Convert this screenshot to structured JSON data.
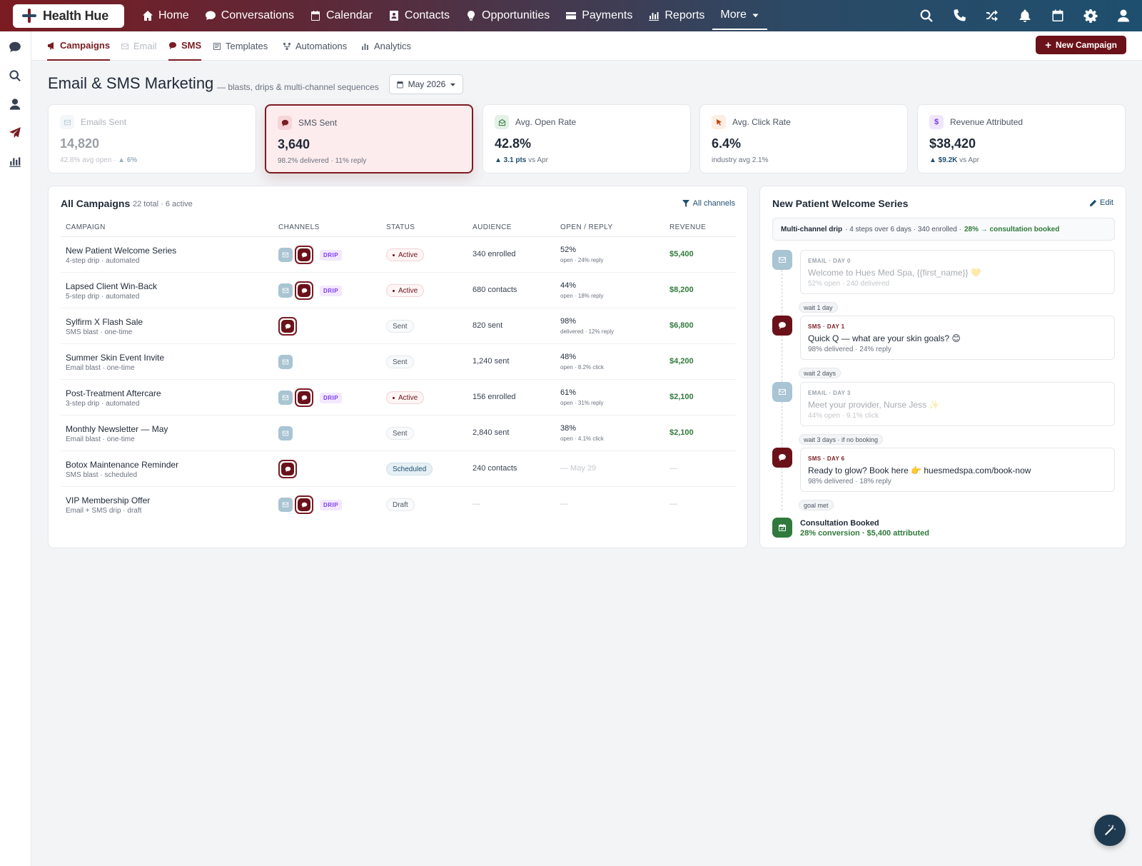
{
  "brand": {
    "name": "Health Hue"
  },
  "topnav": {
    "items": [
      {
        "label": "Home",
        "icon": "home-icon"
      },
      {
        "label": "Conversations",
        "icon": "chat-bubble-icon"
      },
      {
        "label": "Calendar",
        "icon": "calendar-icon"
      },
      {
        "label": "Contacts",
        "icon": "contact-card-icon"
      },
      {
        "label": "Opportunities",
        "icon": "lightbulb-icon"
      },
      {
        "label": "Payments",
        "icon": "credit-card-icon"
      },
      {
        "label": "Reports",
        "icon": "bar-chart-icon"
      }
    ],
    "more_label": "More"
  },
  "subtabs": {
    "campaigns": "Campaigns",
    "email": "Email",
    "sms": "SMS",
    "templates": "Templates",
    "automations": "Automations",
    "analytics": "Analytics",
    "new_campaign": "New Campaign"
  },
  "header": {
    "title": "Email & SMS Marketing",
    "subtitle": "— blasts, drips & multi-channel sequences",
    "month": "May 2026"
  },
  "stats": [
    {
      "label": "Emails Sent",
      "value": "14,820",
      "sub": "42.8% avg open ·",
      "delta": "▲ 6%",
      "icon": "envelope-icon",
      "color": "#a9c4d3"
    },
    {
      "label": "SMS Sent",
      "value": "3,640",
      "sub": "98.2% delivered · 11% reply",
      "delta": "",
      "icon": "sms-icon",
      "color": "#7a1c22"
    },
    {
      "label": "Avg. Open Rate",
      "value": "42.8%",
      "sub": "vs Apr",
      "delta": "▲ 3.1 pts",
      "icon": "envelope-open-icon",
      "color": "#2f7a3c"
    },
    {
      "label": "Avg. Click Rate",
      "value": "6.4%",
      "sub": "industry avg 2.1%",
      "delta": "",
      "icon": "cursor-icon",
      "color": "#c2410c"
    },
    {
      "label": "Revenue Attributed",
      "value": "$38,420",
      "sub": "vs Apr",
      "delta": "▲ $9.2K",
      "icon": "dollar-icon",
      "color": "#7c3aed"
    }
  ],
  "campaigns": {
    "title": "All Campaigns",
    "meta": "22 total · 6 active",
    "filter": "All channels",
    "columns": [
      "Campaign",
      "Channels",
      "Status",
      "Audience",
      "Open / Reply",
      "Revenue"
    ],
    "rows": [
      {
        "name": "New Patient Welcome Series",
        "type": "4-step drip · automated",
        "status": "Active",
        "audience": "340 enrolled",
        "or_main": "52%",
        "or_sub": "open · 24% reply",
        "revenue": "$5,400",
        "drip": "DRIP"
      },
      {
        "name": "Lapsed Client Win-Back",
        "type": "5-step drip · automated",
        "status": "Active",
        "audience": "680 contacts",
        "or_main": "44%",
        "or_sub": "open · 18% reply",
        "revenue": "$8,200",
        "drip": "DRIP"
      },
      {
        "name": "Sylfirm X Flash Sale",
        "type": "SMS blast · one-time",
        "status": "Sent",
        "audience": "820 sent",
        "or_main": "98%",
        "or_sub": "delivered · 12% reply",
        "revenue": "$6,800"
      },
      {
        "name": "Summer Skin Event Invite",
        "type": "Email blast · one-time",
        "status": "Sent",
        "audience": "1,240 sent",
        "or_main": "48%",
        "or_sub": "open · 8.2% click",
        "revenue": "$4,200"
      },
      {
        "name": "Post-Treatment Aftercare",
        "type": "3-step drip · automated",
        "status": "Active",
        "audience": "156 enrolled",
        "or_main": "61%",
        "or_sub": "open · 31% reply",
        "revenue": "$2,100",
        "drip": "DRIP"
      },
      {
        "name": "Monthly Newsletter — May",
        "type": "Email blast · one-time",
        "status": "Sent",
        "audience": "2,840 sent",
        "or_main": "38%",
        "or_sub": "open · 4.1% click",
        "revenue": "$2,100"
      },
      {
        "name": "Botox Maintenance Reminder",
        "type": "SMS blast · scheduled",
        "status": "Scheduled",
        "audience": "240 contacts",
        "or_dash": "— May 29",
        "revenue_dash": "—"
      },
      {
        "name": "VIP Membership Offer",
        "type": "Email + SMS drip · draft",
        "status": "Draft",
        "audience_dash": "—",
        "or_dash": "—",
        "revenue_dash": "—",
        "drip": "DRIP"
      }
    ]
  },
  "workflow": {
    "title": "New Patient Welcome Series",
    "edit": "Edit",
    "summary_bold": "Multi-channel drip",
    "summary": "· 4 steps over 6 days · 340 enrolled ·",
    "summary_green": "28% → consultation booked",
    "steps": [
      {
        "kicker": "EMAIL · DAY 0",
        "message": "Welcome to Hues Med Spa, {{first_name}} 💛",
        "stats": "52% open · 240 delivered"
      },
      {
        "kicker": "SMS · DAY 1",
        "message": "Quick Q — what are your skin goals? 😊",
        "stats": "98% delivered · 24% reply"
      },
      {
        "kicker": "EMAIL · DAY 3",
        "message": "Meet your provider, Nurse Jess ✨",
        "stats": "44% open · 9.1% click"
      },
      {
        "kicker": "SMS · DAY 6",
        "message": "Ready to glow? Book here 👉 huesmedspa.com/book-now",
        "stats": "98% delivered · 18% reply"
      }
    ],
    "waits": [
      "wait 1 day",
      "wait 2 days",
      "wait 3 days · if no booking",
      "goal met"
    ],
    "goal_title": "Consultation Booked",
    "goal_sub": "28% conversion · $5,400 attributed"
  }
}
